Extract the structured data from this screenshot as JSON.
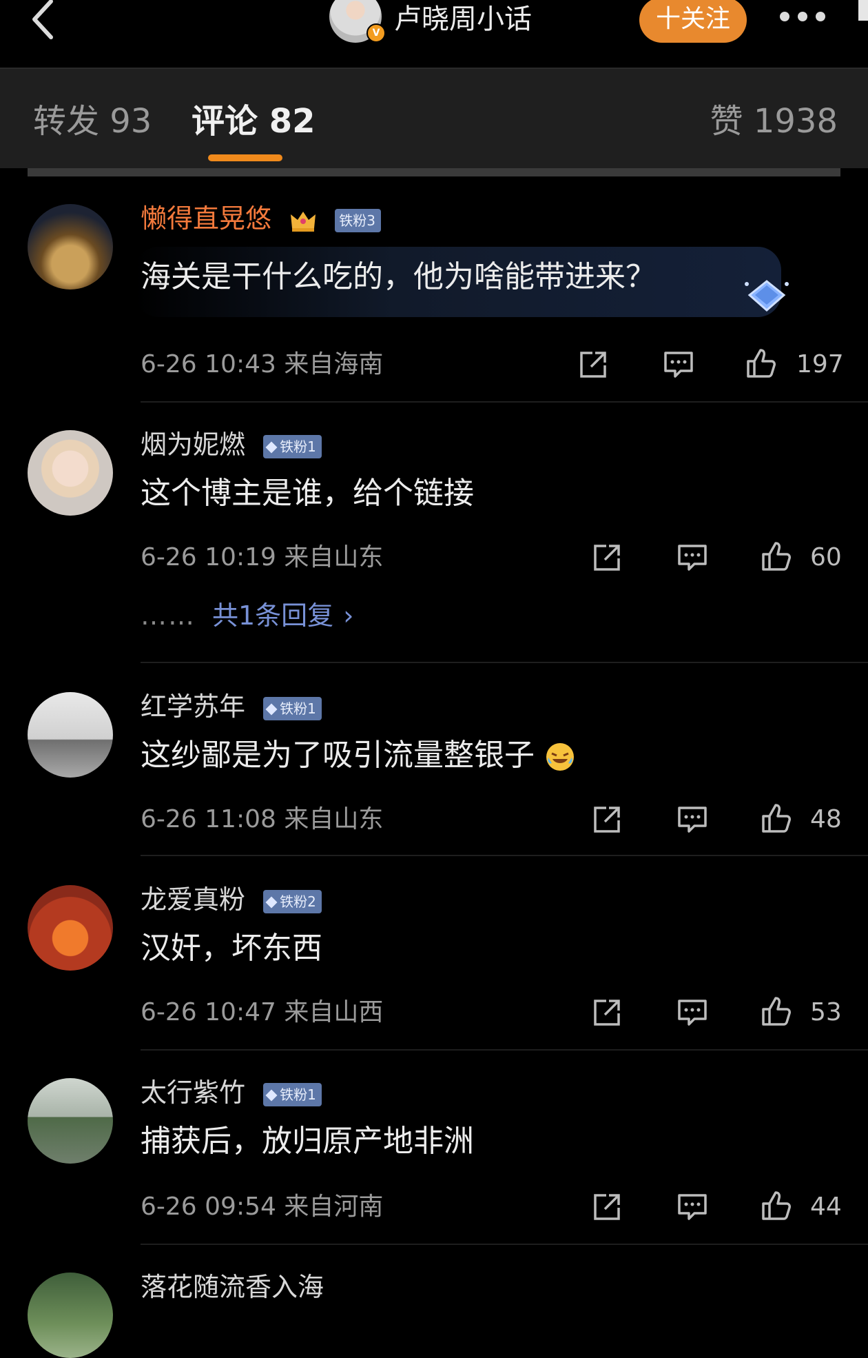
{
  "header": {
    "author_name": "卢晓周小话",
    "verified_badge": "V",
    "follow_label": "十关注",
    "icons": {
      "back": "back-chevron-icon",
      "more": "more-dots-icon"
    }
  },
  "tabs": {
    "repost": "转发 93",
    "comments": "评论 82",
    "likes": "赞 1938"
  },
  "colors": {
    "accent": "#f08a1c",
    "follow_button": "#e8892e",
    "vip_name": "#f47a3c",
    "badge_bg": "#5d77a8",
    "link": "#7891d6"
  },
  "comments": [
    {
      "name": "懒得直晃悠",
      "badge": "铁粉3",
      "text": "海关是干什么吃的，他为啥能带进来？",
      "time": "6-26 10:43",
      "location": "来自海南",
      "likes": "197"
    },
    {
      "name": "烟为妮燃",
      "badge": "铁粉1",
      "text": "这个博主是谁，给个链接",
      "time": "6-26 10:19",
      "location": "来自山东",
      "likes": "60",
      "reply_dots": "……",
      "reply_link": "共1条回复",
      "reply_chevron": "›"
    },
    {
      "name": "红学苏年",
      "badge": "铁粉1",
      "text": "这纱鄙是为了吸引流量整银子",
      "emoji": "crying-laughing-emoji",
      "time": "6-26 11:08",
      "location": "来自山东",
      "likes": "48"
    },
    {
      "name": "龙爱真粉",
      "badge": "铁粉2",
      "text": "汉奸，坏东西",
      "time": "6-26 10:47",
      "location": "来自山西",
      "likes": "53"
    },
    {
      "name": "太行紫竹",
      "badge": "铁粉1",
      "text": "捕获后，放归原产地非洲",
      "time": "6-26 09:54",
      "location": "来自河南",
      "likes": "44"
    },
    {
      "name": "落花随流香入海"
    }
  ]
}
